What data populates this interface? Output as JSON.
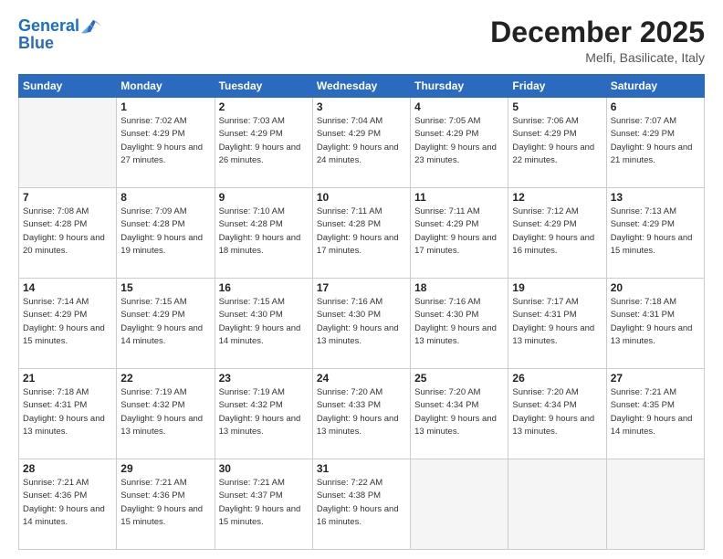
{
  "logo": {
    "line1": "General",
    "line2": "Blue"
  },
  "title": "December 2025",
  "location": "Melfi, Basilicate, Italy",
  "days_header": [
    "Sunday",
    "Monday",
    "Tuesday",
    "Wednesday",
    "Thursday",
    "Friday",
    "Saturday"
  ],
  "weeks": [
    [
      {
        "day": "",
        "empty": true
      },
      {
        "day": "1",
        "sunrise": "7:02 AM",
        "sunset": "4:29 PM",
        "daylight": "9 hours and 27 minutes."
      },
      {
        "day": "2",
        "sunrise": "7:03 AM",
        "sunset": "4:29 PM",
        "daylight": "9 hours and 26 minutes."
      },
      {
        "day": "3",
        "sunrise": "7:04 AM",
        "sunset": "4:29 PM",
        "daylight": "9 hours and 24 minutes."
      },
      {
        "day": "4",
        "sunrise": "7:05 AM",
        "sunset": "4:29 PM",
        "daylight": "9 hours and 23 minutes."
      },
      {
        "day": "5",
        "sunrise": "7:06 AM",
        "sunset": "4:29 PM",
        "daylight": "9 hours and 22 minutes."
      },
      {
        "day": "6",
        "sunrise": "7:07 AM",
        "sunset": "4:29 PM",
        "daylight": "9 hours and 21 minutes."
      }
    ],
    [
      {
        "day": "7",
        "sunrise": "7:08 AM",
        "sunset": "4:28 PM",
        "daylight": "9 hours and 20 minutes."
      },
      {
        "day": "8",
        "sunrise": "7:09 AM",
        "sunset": "4:28 PM",
        "daylight": "9 hours and 19 minutes."
      },
      {
        "day": "9",
        "sunrise": "7:10 AM",
        "sunset": "4:28 PM",
        "daylight": "9 hours and 18 minutes."
      },
      {
        "day": "10",
        "sunrise": "7:11 AM",
        "sunset": "4:28 PM",
        "daylight": "9 hours and 17 minutes."
      },
      {
        "day": "11",
        "sunrise": "7:11 AM",
        "sunset": "4:29 PM",
        "daylight": "9 hours and 17 minutes."
      },
      {
        "day": "12",
        "sunrise": "7:12 AM",
        "sunset": "4:29 PM",
        "daylight": "9 hours and 16 minutes."
      },
      {
        "day": "13",
        "sunrise": "7:13 AM",
        "sunset": "4:29 PM",
        "daylight": "9 hours and 15 minutes."
      }
    ],
    [
      {
        "day": "14",
        "sunrise": "7:14 AM",
        "sunset": "4:29 PM",
        "daylight": "9 hours and 15 minutes."
      },
      {
        "day": "15",
        "sunrise": "7:15 AM",
        "sunset": "4:29 PM",
        "daylight": "9 hours and 14 minutes."
      },
      {
        "day": "16",
        "sunrise": "7:15 AM",
        "sunset": "4:30 PM",
        "daylight": "9 hours and 14 minutes."
      },
      {
        "day": "17",
        "sunrise": "7:16 AM",
        "sunset": "4:30 PM",
        "daylight": "9 hours and 13 minutes."
      },
      {
        "day": "18",
        "sunrise": "7:16 AM",
        "sunset": "4:30 PM",
        "daylight": "9 hours and 13 minutes."
      },
      {
        "day": "19",
        "sunrise": "7:17 AM",
        "sunset": "4:31 PM",
        "daylight": "9 hours and 13 minutes."
      },
      {
        "day": "20",
        "sunrise": "7:18 AM",
        "sunset": "4:31 PM",
        "daylight": "9 hours and 13 minutes."
      }
    ],
    [
      {
        "day": "21",
        "sunrise": "7:18 AM",
        "sunset": "4:31 PM",
        "daylight": "9 hours and 13 minutes."
      },
      {
        "day": "22",
        "sunrise": "7:19 AM",
        "sunset": "4:32 PM",
        "daylight": "9 hours and 13 minutes."
      },
      {
        "day": "23",
        "sunrise": "7:19 AM",
        "sunset": "4:32 PM",
        "daylight": "9 hours and 13 minutes."
      },
      {
        "day": "24",
        "sunrise": "7:20 AM",
        "sunset": "4:33 PM",
        "daylight": "9 hours and 13 minutes."
      },
      {
        "day": "25",
        "sunrise": "7:20 AM",
        "sunset": "4:34 PM",
        "daylight": "9 hours and 13 minutes."
      },
      {
        "day": "26",
        "sunrise": "7:20 AM",
        "sunset": "4:34 PM",
        "daylight": "9 hours and 13 minutes."
      },
      {
        "day": "27",
        "sunrise": "7:21 AM",
        "sunset": "4:35 PM",
        "daylight": "9 hours and 14 minutes."
      }
    ],
    [
      {
        "day": "28",
        "sunrise": "7:21 AM",
        "sunset": "4:36 PM",
        "daylight": "9 hours and 14 minutes."
      },
      {
        "day": "29",
        "sunrise": "7:21 AM",
        "sunset": "4:36 PM",
        "daylight": "9 hours and 15 minutes."
      },
      {
        "day": "30",
        "sunrise": "7:21 AM",
        "sunset": "4:37 PM",
        "daylight": "9 hours and 15 minutes."
      },
      {
        "day": "31",
        "sunrise": "7:22 AM",
        "sunset": "4:38 PM",
        "daylight": "9 hours and 16 minutes."
      },
      {
        "day": "",
        "empty": true
      },
      {
        "day": "",
        "empty": true
      },
      {
        "day": "",
        "empty": true
      }
    ]
  ],
  "labels": {
    "sunrise": "Sunrise:",
    "sunset": "Sunset:",
    "daylight": "Daylight:"
  }
}
